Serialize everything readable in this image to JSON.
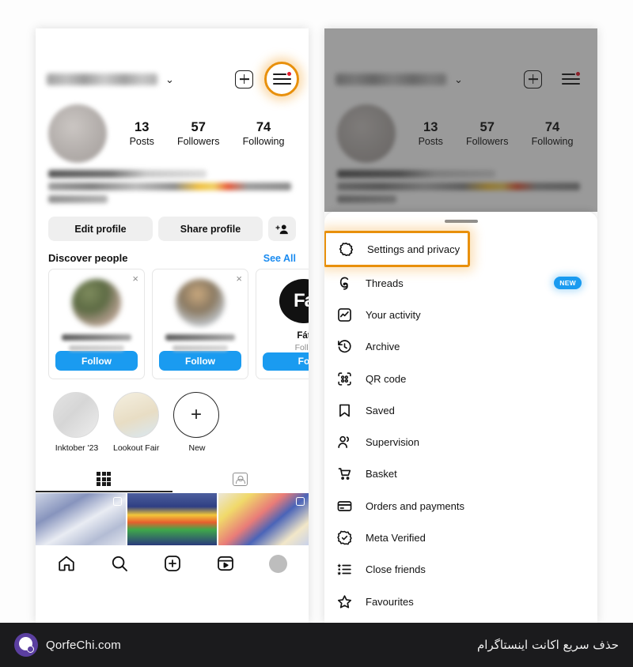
{
  "profile": {
    "username_blurred": true,
    "chevron": "⌄",
    "stats": [
      {
        "num": "13",
        "label": "Posts"
      },
      {
        "num": "57",
        "label": "Followers"
      },
      {
        "num": "74",
        "label": "Following"
      }
    ],
    "buttons": {
      "edit_profile": "Edit profile",
      "share_profile": "Share profile",
      "add_person_icon": "add-person-icon"
    }
  },
  "discover": {
    "title": "Discover people",
    "see_all": "See All",
    "cards": [
      {
        "name_blurred": true,
        "follow": "Follow",
        "close_icon": "×"
      },
      {
        "name_blurred": true,
        "follow": "Follow",
        "close_icon": "×"
      },
      {
        "name": "Fát",
        "sub": "Follo",
        "avatar_text": "Fa",
        "follow": "Fo",
        "close_icon": "×"
      }
    ]
  },
  "highlights": [
    {
      "label": "Inktober '23"
    },
    {
      "label": "Lookout Fair '…"
    },
    {
      "label": "New",
      "is_new": true,
      "icon": "plus-icon"
    }
  ],
  "tabs": [
    {
      "name": "grid-tab",
      "icon": "grid-icon",
      "active": true
    },
    {
      "name": "tagged-tab",
      "icon": "tagged-person-icon",
      "active": false
    }
  ],
  "navbar": [
    {
      "name": "home",
      "icon": "home-icon"
    },
    {
      "name": "search",
      "icon": "search-icon"
    },
    {
      "name": "create",
      "icon": "plus-square-icon"
    },
    {
      "name": "reels",
      "icon": "reels-icon"
    },
    {
      "name": "profile",
      "icon": "avatar-icon"
    }
  ],
  "menu": {
    "items": [
      {
        "label": "Settings and privacy",
        "icon": "gear-icon",
        "highlighted": true
      },
      {
        "label": "Threads",
        "icon": "threads-icon",
        "badge": "NEW"
      },
      {
        "label": "Your activity",
        "icon": "activity-chart-icon"
      },
      {
        "label": "Archive",
        "icon": "clock-rewind-icon"
      },
      {
        "label": "QR code",
        "icon": "qr-code-icon"
      },
      {
        "label": "Saved",
        "icon": "bookmark-icon"
      },
      {
        "label": "Supervision",
        "icon": "people-icon"
      },
      {
        "label": "Basket",
        "icon": "shopping-cart-icon"
      },
      {
        "label": "Orders and payments",
        "icon": "credit-card-icon"
      },
      {
        "label": "Meta Verified",
        "icon": "verified-badge-icon"
      },
      {
        "label": "Close friends",
        "icon": "list-star-icon"
      },
      {
        "label": "Favourites",
        "icon": "star-icon"
      }
    ]
  },
  "footer": {
    "brand": "QorfeChi.com",
    "caption_fa": "حذف سریع  اکانت اینستاگرام",
    "logo_icon": "qorfechi-logo-icon"
  },
  "colors": {
    "accent_orange": "#e8900c",
    "instagram_blue": "#1a9bf0",
    "footer_bg": "#1b1b1d",
    "logo_purple": "#5b3fa0"
  }
}
